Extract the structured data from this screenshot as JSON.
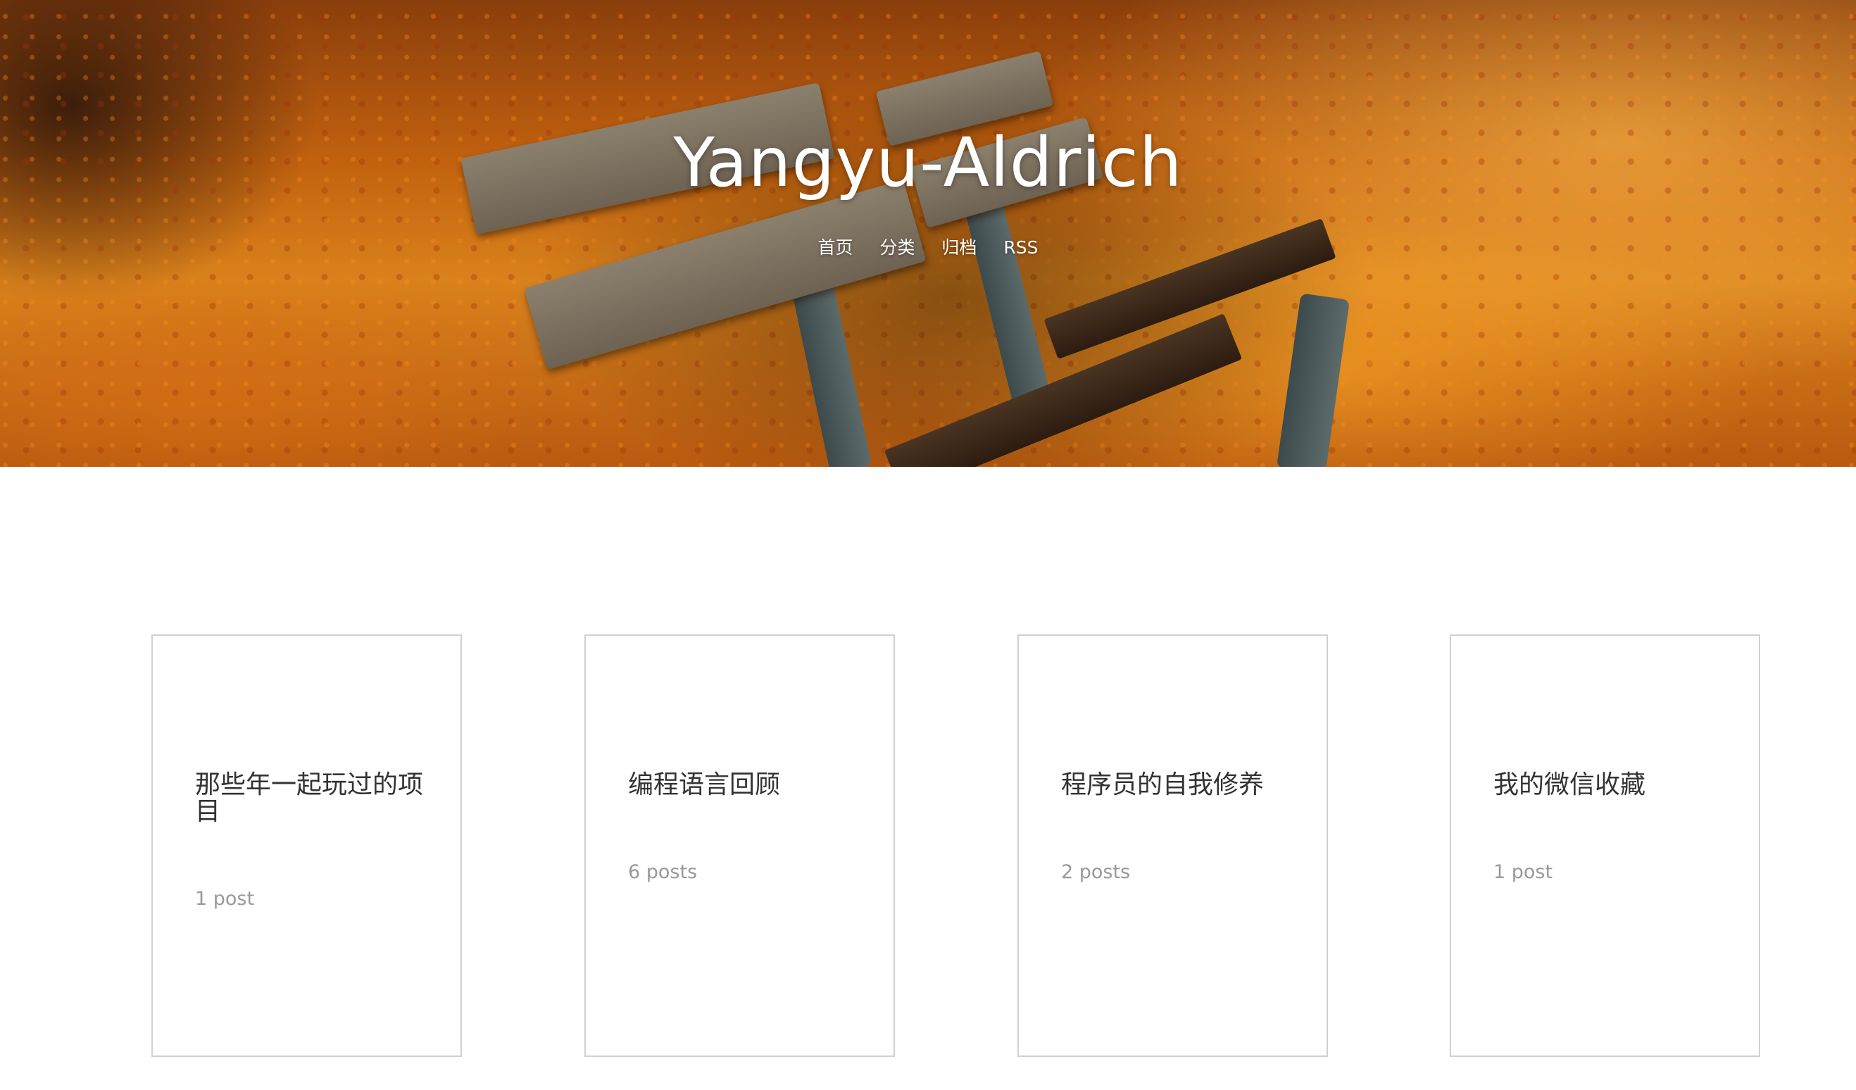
{
  "site": {
    "title": "Yangyu-Aldrich"
  },
  "nav": {
    "items": [
      {
        "label": "首页"
      },
      {
        "label": "分类"
      },
      {
        "label": "归档"
      },
      {
        "label": "RSS"
      }
    ]
  },
  "categories": [
    {
      "title": "那些年一起玩过的项目",
      "count": "1 post"
    },
    {
      "title": "编程语言回顾",
      "count": "6 posts"
    },
    {
      "title": "程序员的自我修养",
      "count": "2 posts"
    },
    {
      "title": "我的微信收藏",
      "count": "1 post"
    }
  ],
  "colors": {
    "card_border": "#d0d0d0",
    "card_title": "#333333",
    "card_count": "#999999",
    "hero_accent": "#d9821c"
  }
}
